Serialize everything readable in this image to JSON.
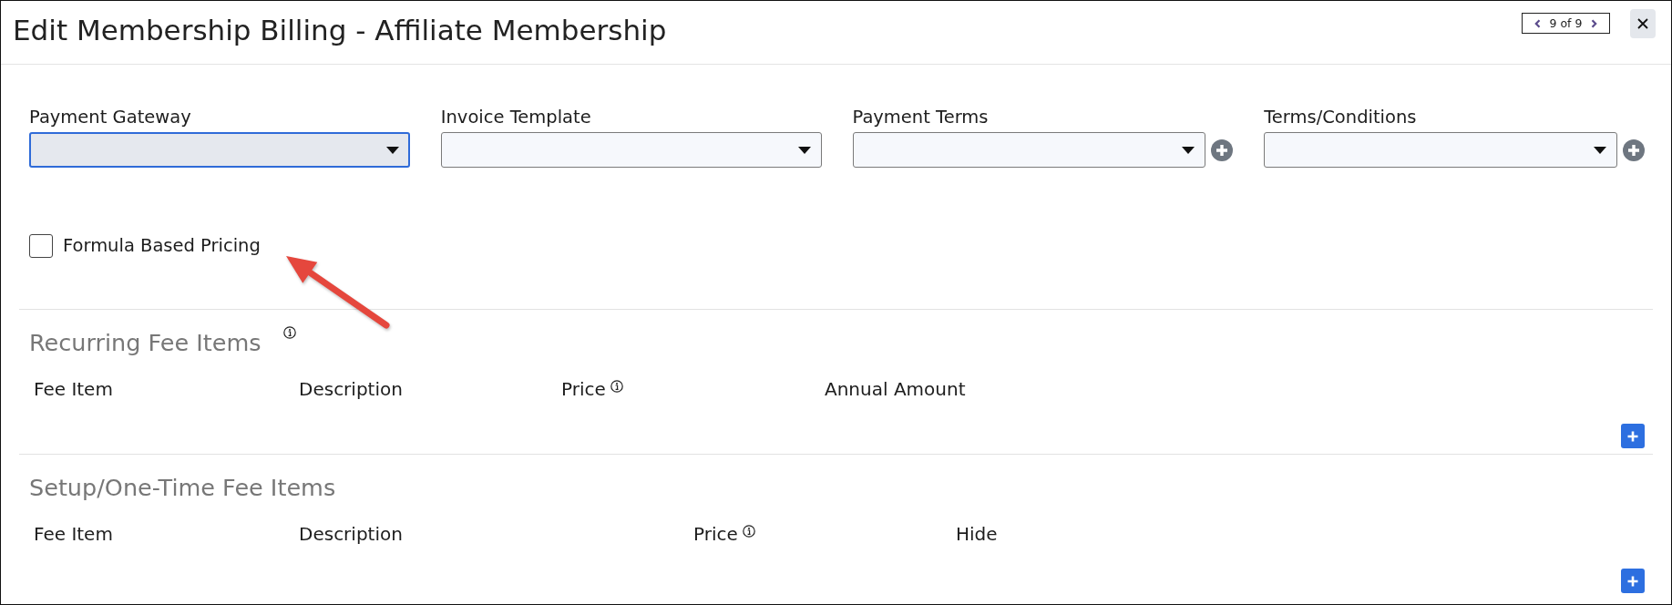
{
  "dialog": {
    "title": "Edit Membership Billing - Affiliate Membership",
    "pager": "9 of 9"
  },
  "fields": [
    {
      "label": "Payment Gateway",
      "focused": true,
      "add_button": false
    },
    {
      "label": "Invoice Template",
      "focused": false,
      "add_button": false
    },
    {
      "label": "Payment Terms",
      "focused": false,
      "add_button": true
    },
    {
      "label": "Terms/Conditions",
      "focused": false,
      "add_button": true
    }
  ],
  "formula_pricing": {
    "label": "Formula Based Pricing",
    "checked": false
  },
  "sections": [
    {
      "title": "Recurring Fee Items",
      "info": true,
      "columns": [
        {
          "label": "Fee Item",
          "info": false
        },
        {
          "label": "Description",
          "info": false
        },
        {
          "label": "Price",
          "info": true
        },
        {
          "label": "Annual Amount",
          "info": false
        }
      ]
    },
    {
      "title": "Setup/One-Time Fee Items",
      "info": false,
      "columns": [
        {
          "label": "Fee Item",
          "info": false
        },
        {
          "label": "Description",
          "info": false
        },
        {
          "label": "Price",
          "info": true
        },
        {
          "label": "Hide",
          "info": false
        }
      ]
    }
  ]
}
